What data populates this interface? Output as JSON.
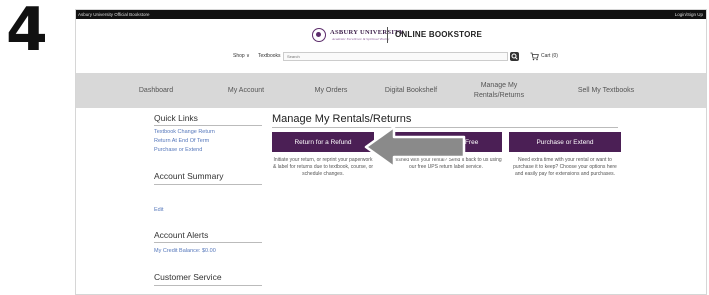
{
  "step_number": "4",
  "topbar": {
    "left_text": "Asbury University Official Bookstore",
    "right_text": "Login/Sign Up"
  },
  "header": {
    "university_name": "ASBURY UNIVERSITY",
    "university_tagline": "Academic Excellence & Spiritual Vitality",
    "store_name": "ONLINE BOOKSTORE",
    "shop_label": "Shop ∨",
    "textbooks_label": "Textbooks",
    "search_placeholder": "Search",
    "search_icon": "magnifier-icon",
    "cart_icon": "cart-icon",
    "cart_label": "Cart (0)"
  },
  "nav": {
    "items": [
      {
        "label": "Dashboard"
      },
      {
        "label": "My Account"
      },
      {
        "label": "My Orders"
      },
      {
        "label": "Digital Bookshelf"
      },
      {
        "label": "Manage My Rentals/Returns"
      },
      {
        "label": "Sell My Textbooks"
      }
    ]
  },
  "sidebar": {
    "quick_links_title": "Quick Links",
    "quick_links": [
      {
        "label": "Textbook Change Return"
      },
      {
        "label": "Return At End Of Term"
      },
      {
        "label": "Purchase or Extend"
      }
    ],
    "account_summary_title": "Account Summary",
    "edit_label": "Edit",
    "account_alerts_title": "Account Alerts",
    "credit_balance": "My Credit Balance: $0.00",
    "customer_service_title": "Customer Service"
  },
  "main": {
    "title": "Manage My Rentals/Returns",
    "actions": [
      {
        "label": "Return for a Refund",
        "description": "Initiate your return, or reprint your paperwork & label for returns due to textbook, course, or schedule changes."
      },
      {
        "label": "Return Rental for Free",
        "description": "Finished with your rental? Send it back to us using our free UPS return label service."
      },
      {
        "label": "Purchase or Extend",
        "description": "Need extra time with your rental or want to purchase it to keep? Choose your options here and easily pay for extensions and purchases."
      }
    ]
  },
  "colors": {
    "brand_purple": "#4b1f55",
    "nav_gray": "#d8d8d8",
    "arrow_gray": "#8a8a8a",
    "link_blue": "#5577bb"
  }
}
